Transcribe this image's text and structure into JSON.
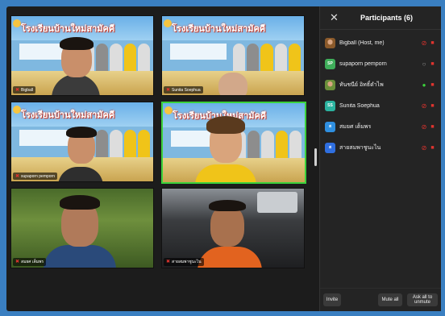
{
  "panel": {
    "title": "Participants (6)",
    "close_icon": "close-icon",
    "participants": [
      {
        "name": "Bigball (Host, me)",
        "avatar": "photo",
        "avatar_color": "#8b5a2b",
        "mic": "off",
        "cam": "off"
      },
      {
        "name": "supaporn pemporn",
        "avatar": "SP",
        "avatar_color": "#3fae5a",
        "mic": "none",
        "cam": "off"
      },
      {
        "name": "ทันชนีย์ อิทธิ์ดำไพ",
        "avatar": "photo",
        "avatar_color": "#6a8f3a",
        "mic": "on",
        "cam": "off"
      },
      {
        "name": "Sunita Soephua",
        "avatar": "SS",
        "avatar_color": "#2bb3a0",
        "mic": "off",
        "cam": "off"
      },
      {
        "name": "สมยศ เต็มพร",
        "avatar": "ส",
        "avatar_color": "#2f8fe0",
        "mic": "off",
        "cam": "off"
      },
      {
        "name": "สายสมพาชูนะไน",
        "avatar": "ส",
        "avatar_color": "#2f6fe0",
        "mic": "off",
        "cam": "off"
      }
    ],
    "invite_label": "Invite",
    "mute_all_label": "Mute all",
    "ask_unmute_label": "Ask all to unmute"
  },
  "gallery": {
    "school_banner": "โรงเรียนบ้านใหม่สามัคคี",
    "tiles": [
      {
        "name": "Bigball",
        "mic_off": true
      },
      {
        "name": "Sunita Soephua",
        "mic_off": true
      },
      {
        "name": "supaporn pemporn",
        "mic_off": true
      },
      {
        "name": "",
        "mic_off": false
      },
      {
        "name": "สมยศ เต็มพร",
        "mic_off": true
      },
      {
        "name": "สายสมพาชูนะไน",
        "mic_off": true
      }
    ]
  },
  "colors": {
    "active_speaker_border": "#3bd13b",
    "mic_off": "#e0342f",
    "mic_on": "#3bd13b",
    "desktop_bg": "#3a7fc1"
  }
}
